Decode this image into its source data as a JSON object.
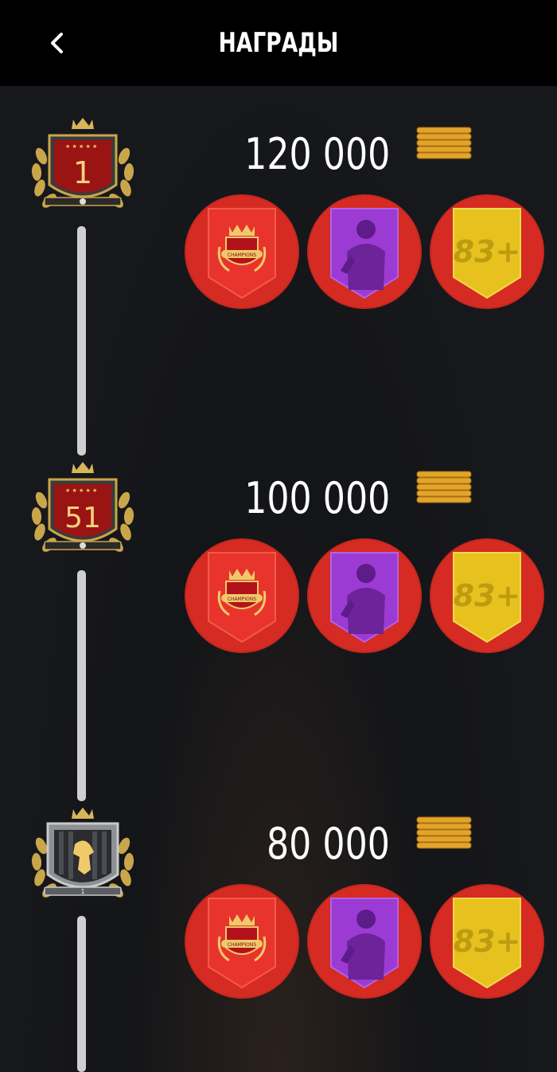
{
  "header": {
    "title": "НАГРАДЫ",
    "back_icon": "chevron-left-icon"
  },
  "tiers": [
    {
      "rank": "1",
      "amount": "120 000",
      "badge_style": "red",
      "pack_label": "83+"
    },
    {
      "rank": "51",
      "amount": "100 000",
      "badge_style": "red",
      "pack_label": "83+"
    },
    {
      "rank": "",
      "amount": "80 000",
      "badge_style": "dark-lion",
      "pack_label": "83+"
    }
  ],
  "colors": {
    "reward_circle": "#d62b22",
    "champions_pack": "#e8342d",
    "player_pack": "#9b3bd4",
    "gold_pack": "#e7c21e",
    "coin": "#e2a52a"
  }
}
